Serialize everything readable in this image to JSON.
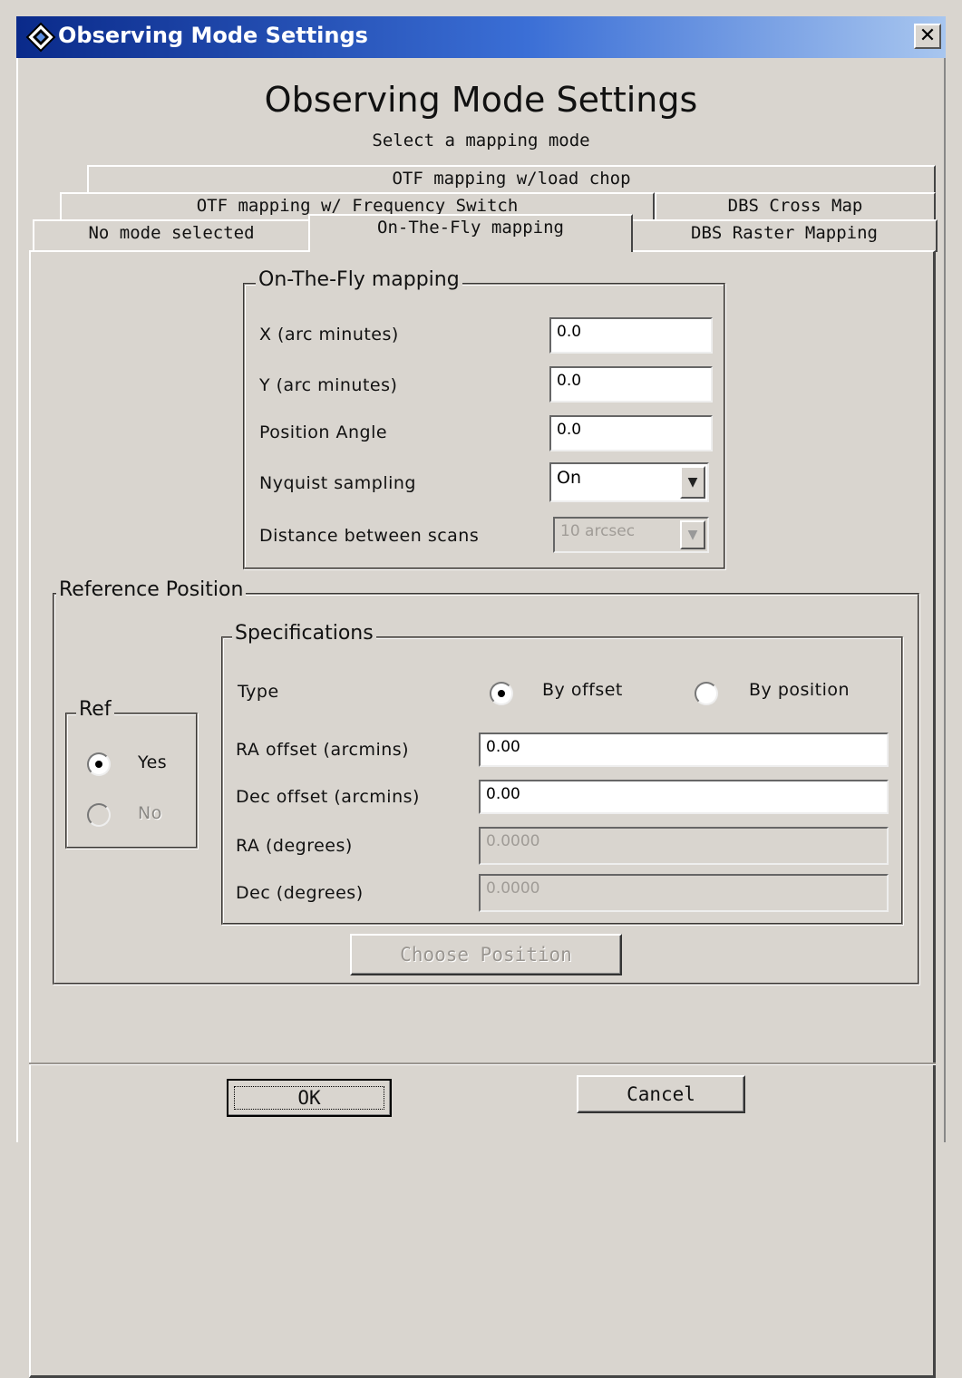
{
  "window": {
    "title": "Observing Mode Settings",
    "close_glyph": "✕"
  },
  "heading": "Observing Mode Settings",
  "subheading": "Select a mapping mode",
  "tabs": {
    "otf_load_chop": "OTF mapping w/load chop",
    "otf_freq_switch": "OTF mapping w/ Frequency Switch",
    "dbs_cross": "DBS Cross Map",
    "no_mode": "No mode selected",
    "otf": "On-The-Fly mapping",
    "dbs_raster": "DBS Raster Mapping",
    "active": "On-The-Fly mapping"
  },
  "otf_group": {
    "title": "On-The-Fly mapping",
    "x_label": "X (arc minutes)",
    "x_value": "0.0",
    "y_label": "Y (arc minutes)",
    "y_value": "0.0",
    "pa_label": "Position Angle",
    "pa_value": "0.0",
    "nyquist_label": "Nyquist sampling",
    "nyquist_value": "On",
    "distance_label": "Distance between scans",
    "distance_value": "10 arcsec"
  },
  "reference": {
    "title": "Reference Position",
    "ref_group": {
      "title": "Ref",
      "yes": "Yes",
      "no": "No",
      "selected": "Yes"
    },
    "specs": {
      "title": "Specifications",
      "type_label": "Type",
      "by_offset": "By offset",
      "by_position": "By position",
      "selected": "By offset",
      "ra_offset_label": "RA offset (arcmins)",
      "ra_offset_value": "0.00",
      "dec_offset_label": "Dec offset (arcmins)",
      "dec_offset_value": "0.00",
      "ra_deg_label": "RA (degrees)",
      "ra_deg_value": "0.0000",
      "dec_deg_label": "Dec (degrees)",
      "dec_deg_value": "0.0000"
    },
    "choose_position": "Choose Position"
  },
  "footer": {
    "ok": "OK",
    "cancel": "Cancel"
  }
}
